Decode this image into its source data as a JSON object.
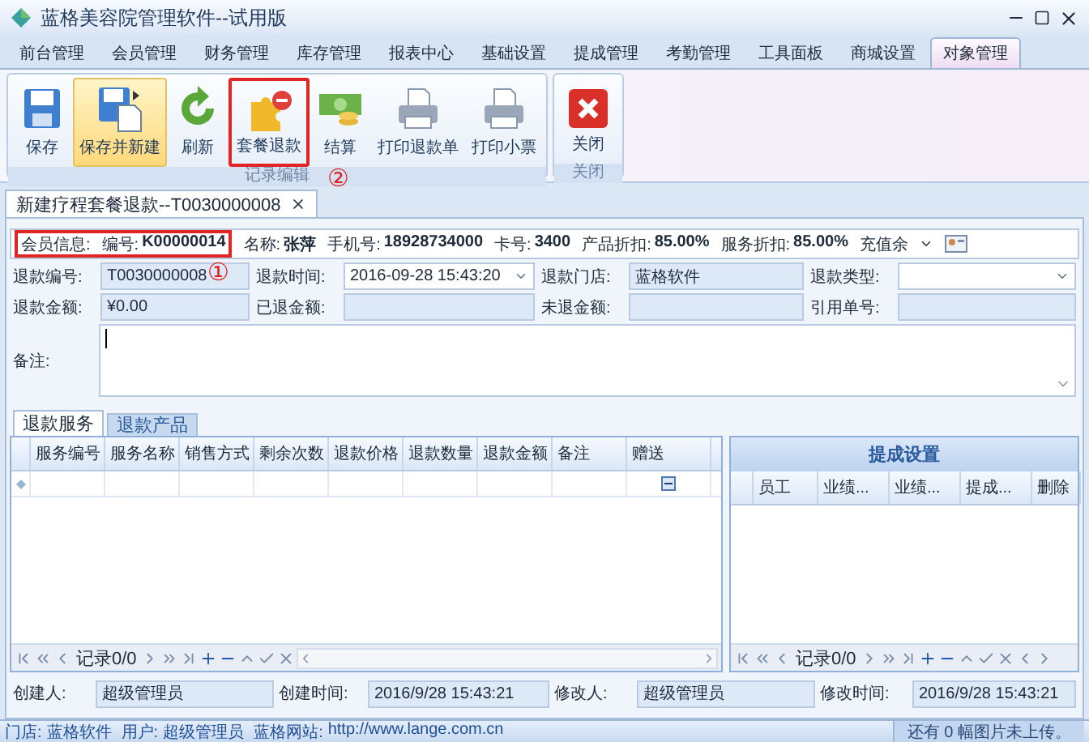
{
  "window": {
    "title": "蓝格美容院管理软件--试用版"
  },
  "menu_tabs": [
    {
      "label": "前台管理",
      "selected": false
    },
    {
      "label": "会员管理",
      "selected": false
    },
    {
      "label": "财务管理",
      "selected": false
    },
    {
      "label": "库存管理",
      "selected": false
    },
    {
      "label": "报表中心",
      "selected": false
    },
    {
      "label": "基础设置",
      "selected": false
    },
    {
      "label": "提成管理",
      "selected": false
    },
    {
      "label": "考勤管理",
      "selected": false
    },
    {
      "label": "工具面板",
      "selected": false
    },
    {
      "label": "商城设置",
      "selected": false
    },
    {
      "label": "对象管理",
      "selected": true
    }
  ],
  "ribbon_groups": [
    {
      "label": "记录编辑",
      "buttons": [
        {
          "kind": "save",
          "label": "保存",
          "hovered": false,
          "highlighted": false
        },
        {
          "kind": "save-new",
          "label": "保存并新建",
          "hovered": true,
          "highlighted": false
        },
        {
          "kind": "refresh",
          "label": "刷新",
          "hovered": false,
          "highlighted": false
        },
        {
          "kind": "package-refund",
          "label": "套餐退款",
          "hovered": false,
          "highlighted": true,
          "marker": "②"
        },
        {
          "kind": "checkout",
          "label": "结算",
          "hovered": false,
          "highlighted": false
        },
        {
          "kind": "print",
          "label": "打印退款单",
          "hovered": false,
          "highlighted": false
        },
        {
          "kind": "print",
          "label": "打印小票",
          "hovered": false,
          "highlighted": false
        }
      ]
    },
    {
      "label": "关闭",
      "buttons": [
        {
          "kind": "close",
          "label": "关闭",
          "hovered": false,
          "highlighted": false
        }
      ]
    }
  ],
  "document_tab": {
    "label": "新建疗程套餐退款--T0030000008"
  },
  "member_info": {
    "label": "会员信息:",
    "highlighted": true,
    "marker": "①",
    "fields": [
      {
        "label": "编号:",
        "value": "K00000014"
      },
      {
        "label": "名称:",
        "value": "张萍"
      },
      {
        "label": "手机号:",
        "value": "18928734000"
      },
      {
        "label": "卡号:",
        "value": "3400"
      },
      {
        "label": "产品折扣:",
        "value": "85.00%"
      },
      {
        "label": "服务折扣:",
        "value": "85.00%"
      }
    ],
    "dropdown": "充值余"
  },
  "form_rows": [
    [
      {
        "label": "退款编号:",
        "value": "T0030000008",
        "kind": "text"
      },
      {
        "label": "退款时间:",
        "value": "2016-09-28 15:43:20",
        "kind": "date"
      },
      {
        "label": "退款门店:",
        "value": "蓝格软件",
        "kind": "text"
      },
      {
        "label": "退款类型:",
        "kind": "select"
      }
    ],
    [
      {
        "label": "退款金额:",
        "value": "¥0.00",
        "kind": "text"
      },
      {
        "label": "已退金额:",
        "kind": "text"
      },
      {
        "label": "未退金额:",
        "kind": "text"
      },
      {
        "label": "引用单号:",
        "kind": "text"
      }
    ]
  ],
  "notes": {
    "label": "备注:"
  },
  "sub_tabs": [
    {
      "label": "退款服务",
      "selected": true
    },
    {
      "label": "退款产品",
      "selected": false
    }
  ],
  "service_table": {
    "columns": [
      "服务编号",
      "服务名称",
      "销售方式",
      "剩余次数",
      "退款价格",
      "退款数量",
      "退款金额",
      "备注",
      "赠送"
    ],
    "record_count": "记录0/0"
  },
  "commission_panel": {
    "title": "提成设置",
    "columns": [
      "员工",
      "业绩...",
      "业绩...",
      "提成...",
      "删除"
    ],
    "record_count": "记录0/0"
  },
  "footer": [
    {
      "label": "创建人:",
      "value": "超级管理员"
    },
    {
      "label": "创建时间:",
      "value": "2016/9/28 15:43:21"
    },
    {
      "label": "修改人:",
      "value": "超级管理员"
    },
    {
      "label": "修改时间:",
      "value": "2016/9/28 15:43:21"
    }
  ],
  "status_bar": {
    "items": [
      {
        "label": "门店:",
        "value": "蓝格软件"
      },
      {
        "label": "用户:",
        "value": "超级管理员"
      },
      {
        "label": "蓝格网站:",
        "value": "http://www.lange.com.cn"
      }
    ],
    "notice": "还有 0 幅图片未上传。"
  }
}
